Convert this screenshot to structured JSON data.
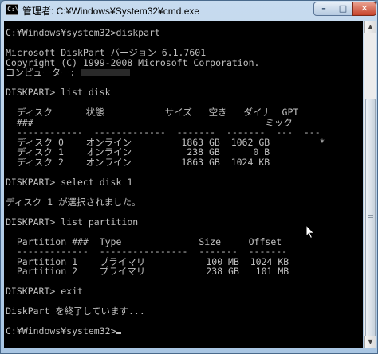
{
  "window": {
    "title": "管理者: C:¥Windows¥System32¥cmd.exe",
    "app_icon_text": "C:\\"
  },
  "titlebar_buttons": {
    "minimize": "–",
    "maximize": "□",
    "close": "✕"
  },
  "console": {
    "lines_before_name": "C:¥Windows¥system32>diskpart\n\nMicrosoft DiskPart バージョン 6.1.7601\nCopyright (C) 1999-2008 Microsoft Corporation.\nコンピューター: ",
    "lines_after_name": "\n\nDISKPART> list disk\n\n  ディスク      状態           サイズ   空き   ダイナ  GPT\n  ###                                          ミック\n  ------------  -------------  -------  -------  ---  ---\n  ディスク 0    オンライン         1863 GB  1062 GB         *\n  ディスク 1    オンライン          238 GB      0 B\n  ディスク 2    オンライン         1863 GB  1024 KB\n\nDISKPART> select disk 1\n\nディスク 1 が選択されました。\n\nDISKPART> list partition\n\n  Partition ###  Type              Size     Offset\n  -------------  ----------------  -------  -------\n  Partition 1    プライマリ           100 MB  1024 KB\n  Partition 2    プライマリ           238 GB   101 MB\n\nDISKPART> exit\n\nDiskPart を終了しています...\n\n",
    "prompt_line": "C:¥Windows¥system32>"
  },
  "scrollbar": {
    "up_arrow": "▲",
    "down_arrow": "▼"
  }
}
